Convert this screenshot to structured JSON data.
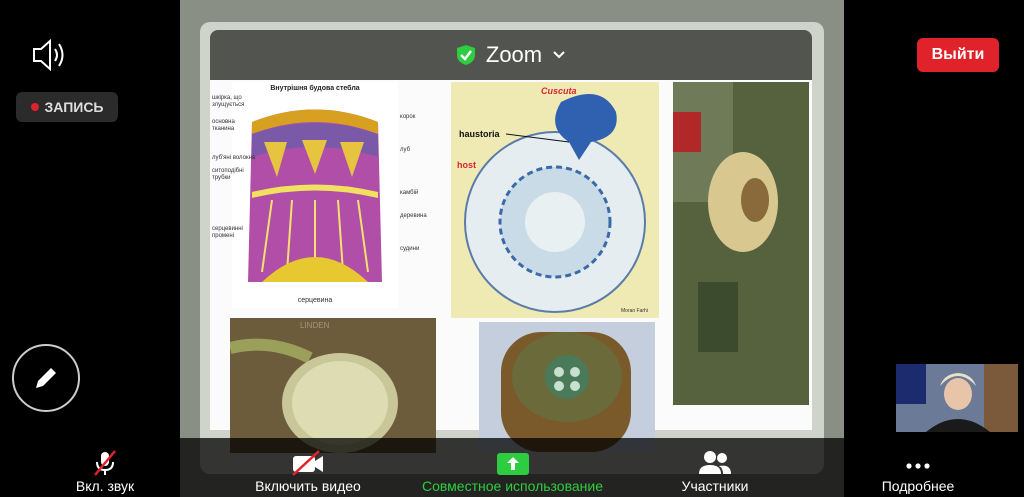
{
  "topbar": {
    "title": "Zoom"
  },
  "header": {
    "exit_label": "Выйти",
    "recording_label": "ЗАПИСЬ"
  },
  "slide": {
    "stem_title": "Внутрішня будова стебла",
    "stem_labels_left": [
      "шкірка, що злущується",
      "основна тканина",
      "луб'яні волокна",
      "ситоподібні трубки",
      "серцевинні промені"
    ],
    "stem_labels_right": [
      "корок",
      "луб",
      "камбій",
      "деревина",
      "судини"
    ],
    "stem_bottom": "серцевина",
    "cuscuta_title": "Cuscuta",
    "cuscuta_haustoria": "haustoria",
    "cuscuta_host": "host",
    "cuscuta_credit": "Moran Farhi",
    "watermark": "LINDEN"
  },
  "toolbar": {
    "audio_label": "Вкл. звук",
    "video_label": "Включить видео",
    "share_label": "Совместное использование",
    "participants_label": "Участники",
    "more_label": "Подробнее"
  },
  "colors": {
    "accent_green": "#2ecc40",
    "exit_red": "#e0232a"
  }
}
